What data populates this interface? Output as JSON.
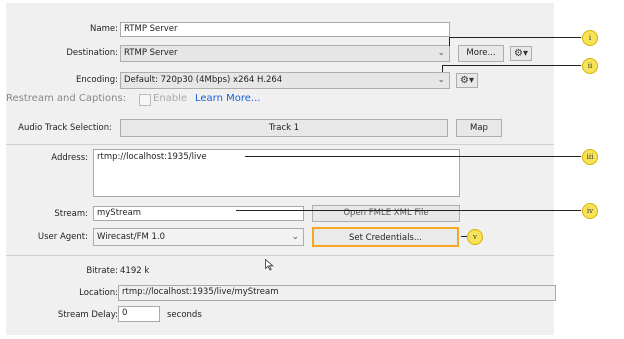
{
  "form": {
    "name_label": "Name:",
    "name_value": "RTMP Server",
    "destination_label": "Destination:",
    "destination_value": "RTMP Server",
    "more_button": "More...",
    "encoding_label": "Encoding:",
    "encoding_value": "Default: 720p30 (4Mbps) x264 H.264",
    "restream_label": "Restream and Captions:",
    "enable_label": "Enable",
    "learn_more": "Learn More...",
    "audio_track_label": "Audio Track Selection:",
    "audio_track_value": "Track 1",
    "map_button": "Map",
    "address_label": "Address:",
    "address_value": "rtmp://localhost:1935/live",
    "stream_label": "Stream:",
    "stream_value": "myStream",
    "open_fmle_button": "Open FMLE XML File",
    "user_agent_label": "User Agent:",
    "user_agent_value": "Wirecast/FM 1.0",
    "set_credentials_button": "Set Credentials...",
    "bitrate_label": "Bitrate:",
    "bitrate_value": "4192 k",
    "location_label": "Location:",
    "location_value": "rtmp://localhost:1935/live/myStream",
    "stream_delay_label": "Stream Delay:",
    "stream_delay_value": "0",
    "seconds_label": "seconds"
  },
  "callouts": [
    "i",
    "ii",
    "iii",
    "iv",
    "v"
  ],
  "colors": {
    "highlight": "#f5a623",
    "badge": "#f7e25a",
    "link": "#1a5fd6"
  }
}
